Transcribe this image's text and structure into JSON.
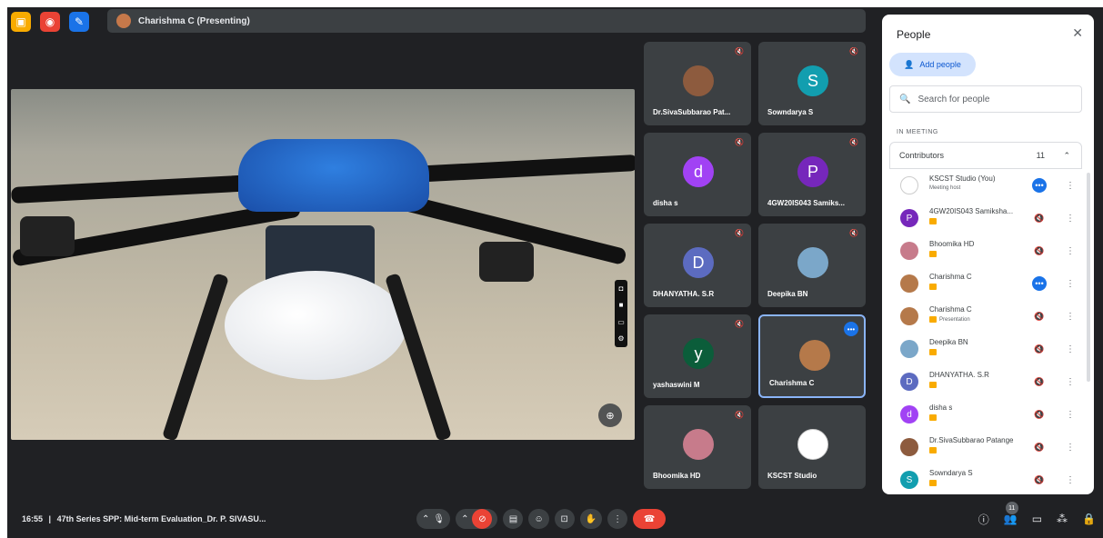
{
  "topbar": {
    "buttons": [
      {
        "icon": "presentation-icon",
        "glyph": "▣",
        "color": "#f9ab00"
      },
      {
        "icon": "record-icon",
        "glyph": "◉",
        "color": "#ea4335"
      },
      {
        "icon": "whiteboard-icon",
        "glyph": "✎",
        "color": "#1a73e8"
      }
    ],
    "presenting_label": "Charishma C (Presenting)"
  },
  "tiles": [
    {
      "name": "Dr.SivaSubbarao Pat...",
      "initial": "",
      "avatar_color": "#8d5b3e",
      "muted": true
    },
    {
      "name": "Sowndarya S",
      "initial": "S",
      "avatar_color": "#129eaf",
      "muted": true
    },
    {
      "name": "disha s",
      "initial": "d",
      "avatar_color": "#a142f4",
      "muted": true
    },
    {
      "name": "4GW20IS043 Samiks...",
      "initial": "P",
      "avatar_color": "#7627bb",
      "muted": true
    },
    {
      "name": "DHANYATHA. S.R",
      "initial": "D",
      "avatar_color": "#5c6bc0",
      "muted": true
    },
    {
      "name": "Deepika BN",
      "initial": "",
      "avatar_color": "#7ba7c9",
      "muted": true
    },
    {
      "name": "yashaswini M",
      "initial": "y",
      "avatar_color": "#0b5d3a",
      "muted": true
    },
    {
      "name": "Charishma C",
      "initial": "",
      "avatar_color": "#b5794a",
      "muted": false
    },
    {
      "name": "Bhoomika HD",
      "initial": "",
      "avatar_color": "#c77b8b",
      "muted": true
    },
    {
      "name": "KSCST Studio",
      "initial": "",
      "avatar_color": "#ffffff",
      "muted": false
    }
  ],
  "bottombar": {
    "time": "16:55",
    "separator": "|",
    "meeting_title": "47th Series SPP: Mid-term Evaluation_Dr. P. SIVASU...",
    "participant_count": "11"
  },
  "panel": {
    "title": "People",
    "add_people": "Add people",
    "search_placeholder": "Search for people",
    "section_label": "IN MEETING",
    "group_label": "Contributors",
    "group_count": "11",
    "participants": [
      {
        "name": "KSCST Studio (You)",
        "sub": "Meeting host",
        "initial": "",
        "color": "#ffffff",
        "action": "more",
        "tag": false
      },
      {
        "name": "4GW20IS043 Samiksha...",
        "sub": "",
        "initial": "P",
        "color": "#7627bb",
        "action": "muted",
        "tag": true
      },
      {
        "name": "Bhoomika HD",
        "sub": "",
        "initial": "",
        "color": "#c77b8b",
        "action": "muted",
        "tag": true
      },
      {
        "name": "Charishma C",
        "sub": "",
        "initial": "",
        "color": "#b5794a",
        "action": "more",
        "tag": true
      },
      {
        "name": "Charishma C",
        "sub": "Presentation",
        "initial": "",
        "color": "#b5794a",
        "action": "muted",
        "tag": true
      },
      {
        "name": "Deepika BN",
        "sub": "",
        "initial": "",
        "color": "#7ba7c9",
        "action": "muted",
        "tag": true
      },
      {
        "name": "DHANYATHA. S.R",
        "sub": "",
        "initial": "D",
        "color": "#5c6bc0",
        "action": "muted",
        "tag": true
      },
      {
        "name": "disha s",
        "sub": "",
        "initial": "d",
        "color": "#a142f4",
        "action": "muted",
        "tag": true
      },
      {
        "name": "Dr.SivaSubbarao Patange",
        "sub": "",
        "initial": "",
        "color": "#8d5b3e",
        "action": "muted",
        "tag": true
      },
      {
        "name": "Sowndarya S",
        "sub": "",
        "initial": "S",
        "color": "#129eaf",
        "action": "muted",
        "tag": true
      }
    ]
  }
}
